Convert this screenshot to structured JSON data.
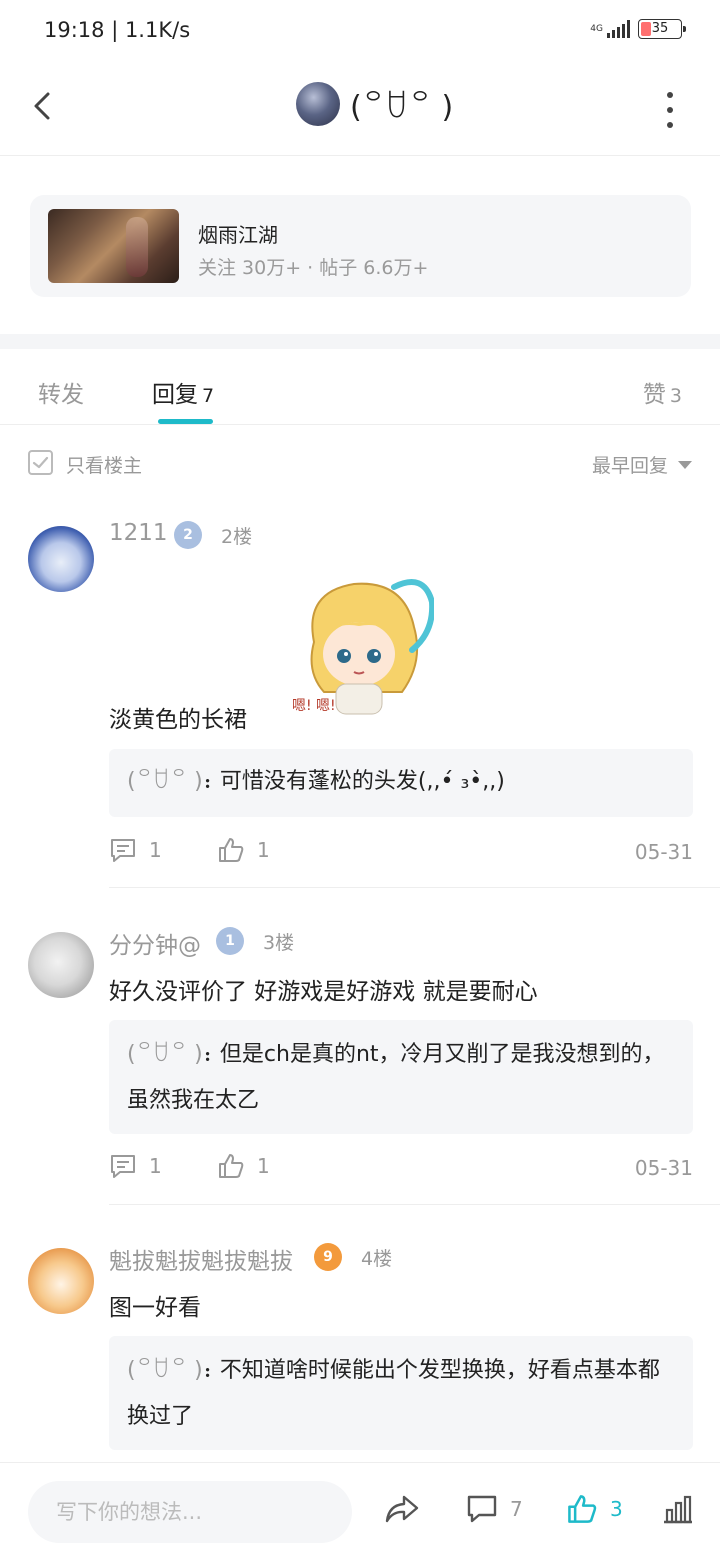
{
  "status_bar": {
    "time": "19:18 | 1.1K/s",
    "network": "4G",
    "battery": "35"
  },
  "header": {
    "title": "(꒪ꇴ꒪ )"
  },
  "forum": {
    "name": "烟雨江湖",
    "stats": "关注 30万+ · 帖子 6.6万+"
  },
  "tabs": {
    "repost": {
      "label": "转发"
    },
    "reply": {
      "label": "回复",
      "count": "7"
    },
    "like": {
      "label": "赞",
      "count": "3"
    }
  },
  "filter": {
    "op_only": "只看楼主",
    "sort": "最早回复"
  },
  "posts": [
    {
      "user": "1211",
      "level": "2",
      "floor": "2楼",
      "text": "淡黄色的长裙",
      "sub_reply_author": "(꒪ꇴ꒪ )",
      "sub_reply_text": "：可惜没有蓬松的头发(,,•́ ₃•̀,,)",
      "comments": "1",
      "likes": "1",
      "date": "05-31"
    },
    {
      "user": "分分钟@",
      "level": "1",
      "floor": "3楼",
      "text": "好久没评价了 好游戏是好游戏 就是要耐心",
      "sub_reply_author": "(꒪ꇴ꒪ )",
      "sub_reply_text": "：但是ch是真的nt，冷月又削了是我没想到的，虽然我在太乙",
      "comments": "1",
      "likes": "1",
      "date": "05-31"
    },
    {
      "user": "魁拔魁拔魁拔魁拔",
      "level": "9",
      "floor": "4楼",
      "text": "图一好看",
      "sub_reply_author": "(꒪ꇴ꒪ )",
      "sub_reply_text": "：不知道啥时候能出个发型换换，好看点基本都换过了"
    }
  ],
  "sticker_text": "嗯! 嗯!",
  "bottom_bar": {
    "placeholder": "写下你的想法...",
    "comments": "7",
    "likes": "3"
  },
  "colors": {
    "accent": "#1ebac9",
    "muted": "#999999",
    "card_bg": "#f5f6f8"
  }
}
